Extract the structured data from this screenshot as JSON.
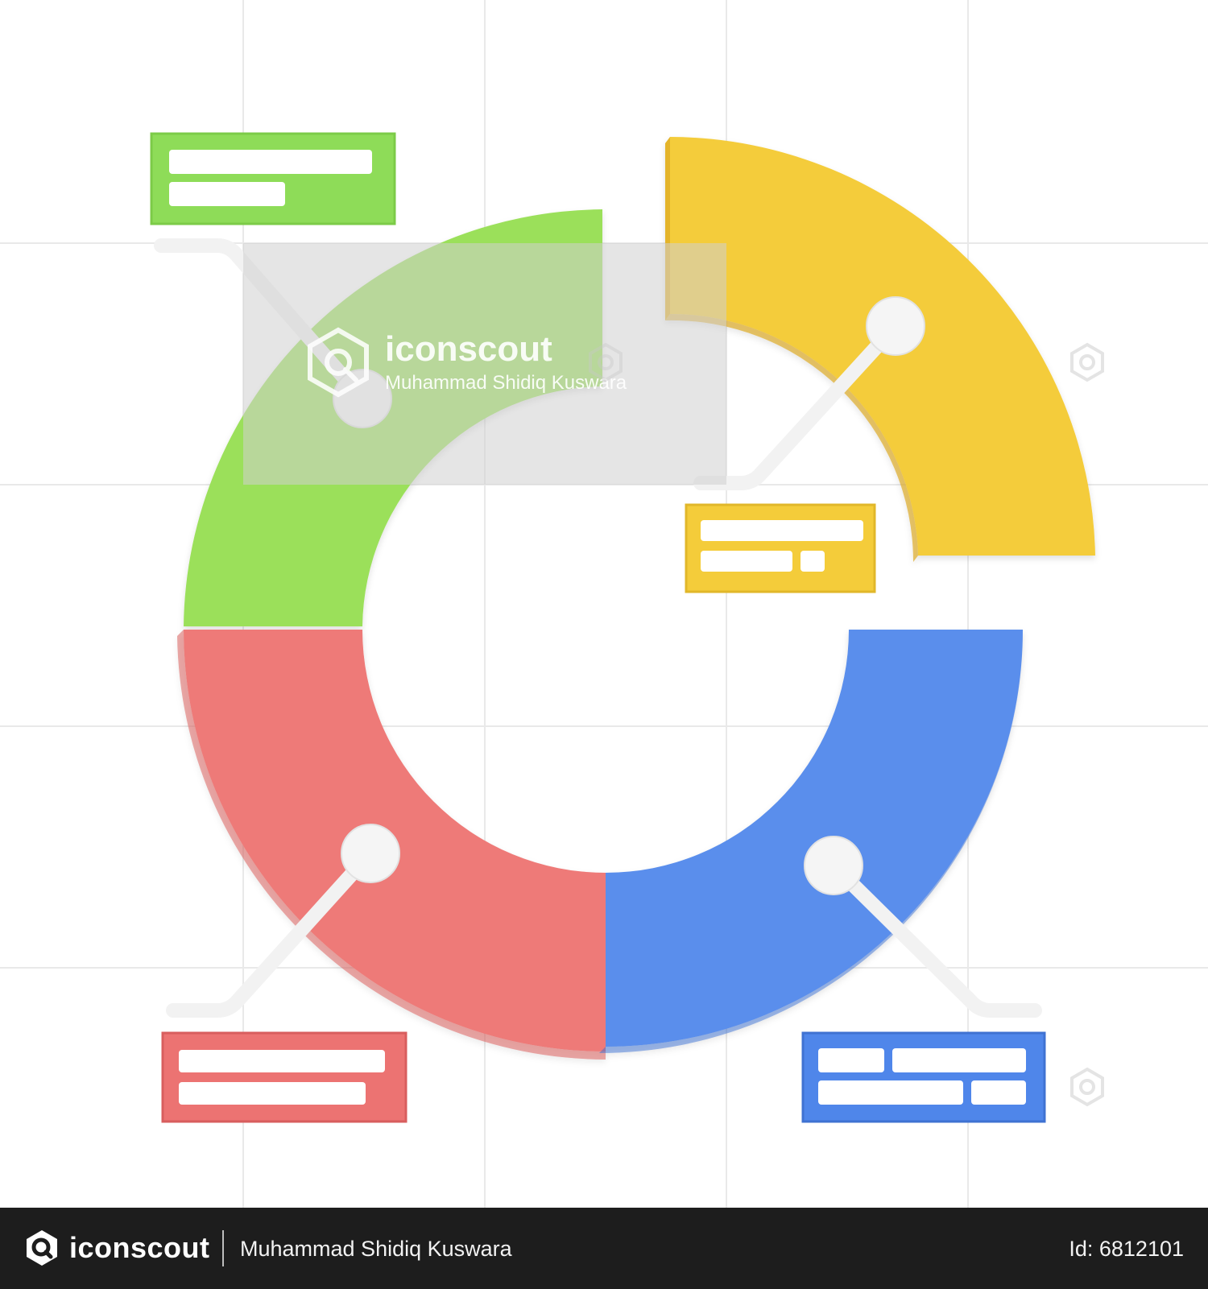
{
  "illustration": {
    "subject": "donut-chart-infographic",
    "segments": [
      {
        "name": "green-segment",
        "color": "#9BE05A",
        "quarter": "top-left"
      },
      {
        "name": "yellow-segment",
        "color": "#F4CC3A",
        "quarter": "top-right",
        "exploded": true
      },
      {
        "name": "red-segment",
        "color": "#EE7A78",
        "quarter": "bottom-left"
      },
      {
        "name": "blue-segment",
        "color": "#5A8EEC",
        "quarter": "bottom-right"
      }
    ],
    "callout_colors": {
      "green": "#8EDC58",
      "yellow": "#F4CC3A",
      "red": "#EC7372",
      "blue": "#4F86EA"
    },
    "connector_color": "#FFFFFF",
    "grid": true
  },
  "watermark": {
    "brand": "iconscout",
    "author": "Muhammad Shidiq Kuswara"
  },
  "footer": {
    "brand": "iconscout",
    "author": "Muhammad Shidiq Kuswara",
    "asset_id": "Id: 6812101"
  }
}
